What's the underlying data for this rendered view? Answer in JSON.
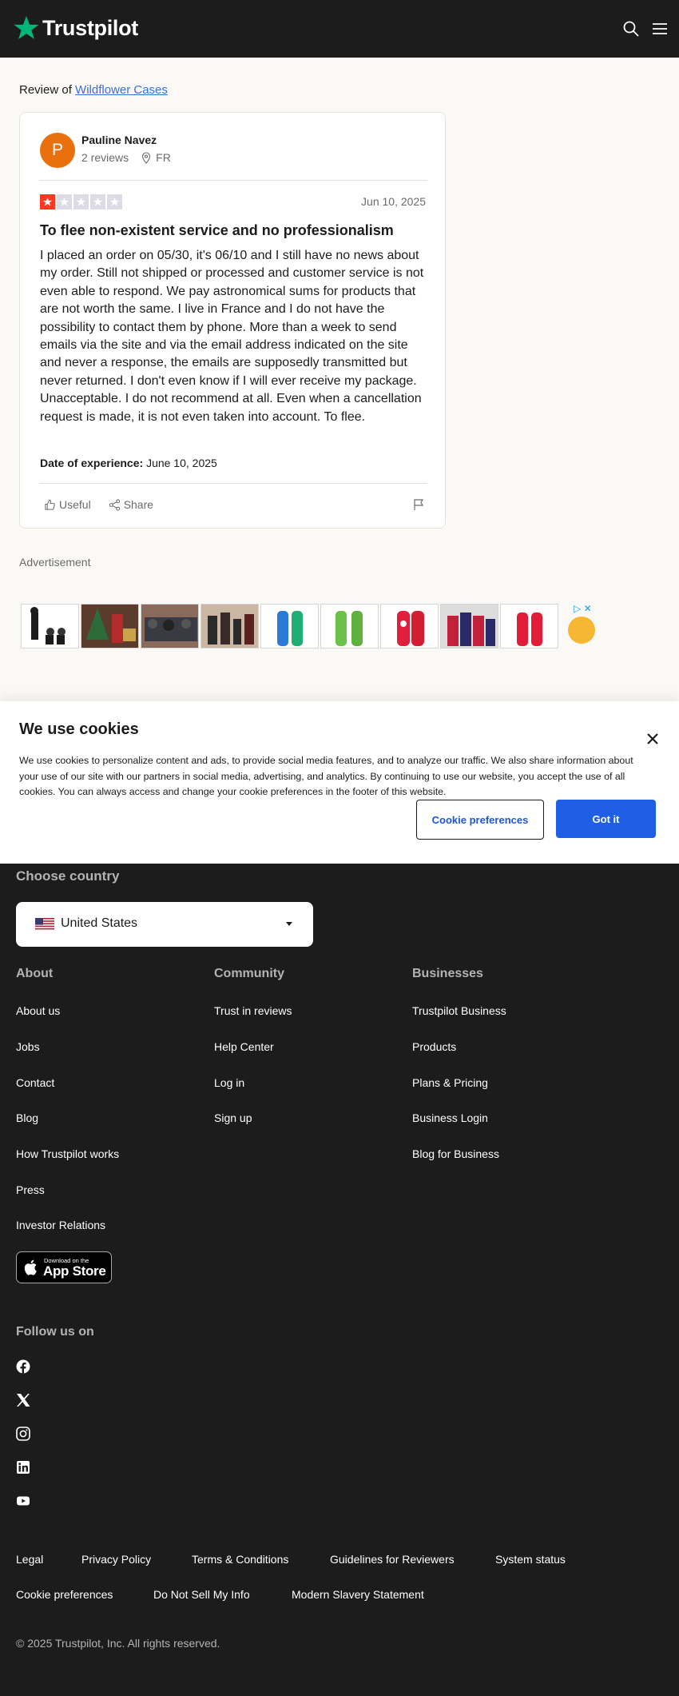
{
  "header": {
    "brand": "Trustpilot"
  },
  "review_of": {
    "prefix": "Review of",
    "company": "Wildflower Cases"
  },
  "review": {
    "avatar_letter": "P",
    "author": "Pauline Navez",
    "review_count": "2 reviews",
    "country": "FR",
    "rating": 1,
    "rating_max": 5,
    "date": "Jun 10, 2025",
    "title": "To flee non-existent service and no professionalism",
    "body": "I placed an order on 05/30, it's 06/10 and I still have no news about my order. Still not shipped or processed and customer service is not even able to respond. We pay astronomical sums for products that are not worth the same. I live in France and I do not have the possibility to contact them by phone. More than a week to send emails via the site and via the email address indicated on the site and never a response, the emails are supposedly transmitted but never returned. I don't even know if I will ever receive my package. Unacceptable. I do not recommend at all. Even when a cancellation request is made, it is not even taken into account. To flee.",
    "experience_label": "Date of experience:",
    "experience_date": "June 10, 2025",
    "useful_label": "Useful",
    "share_label": "Share"
  },
  "ad": {
    "label": "Advertisement"
  },
  "cookie": {
    "title": "We use cookies",
    "text": "We use cookies to personalize content and ads, to provide social media features, and to analyze our traffic. We also share information about your use of our site with our partners in social media, advertising, and analytics. By continuing to use our website, you accept the use of all cookies. You can always access and change your cookie preferences in the footer of this website.",
    "preferences_label": "Cookie preferences",
    "accept_label": "Got it"
  },
  "footer": {
    "country_heading": "Choose country",
    "country_selected": "United States",
    "columns": [
      {
        "heading": "About",
        "links": [
          "About us",
          "Jobs",
          "Contact",
          "Blog",
          "How Trustpilot works",
          "Press",
          "Investor Relations"
        ]
      },
      {
        "heading": "Community",
        "links": [
          "Trust in reviews",
          "Help Center",
          "Log in",
          "Sign up"
        ]
      },
      {
        "heading": "Businesses",
        "links": [
          "Trustpilot Business",
          "Products",
          "Plans & Pricing",
          "Business Login",
          "Blog for Business"
        ]
      }
    ],
    "app_store": {
      "small": "Download on the",
      "big": "App Store"
    },
    "follow_heading": "Follow us on",
    "social": [
      "facebook-icon",
      "x-icon",
      "instagram-icon",
      "linkedin-icon",
      "youtube-icon"
    ],
    "legal_row1": [
      "Legal",
      "Privacy Policy",
      "Terms & Conditions",
      "Guidelines for Reviewers",
      "System status"
    ],
    "legal_row2": [
      "Cookie preferences",
      "Do Not Sell My Info",
      "Modern Slavery Statement"
    ],
    "copyright": "© 2025 Trustpilot, Inc. All rights reserved."
  },
  "colors": {
    "brand_green": "#00b67a",
    "star_red": "#ff3722",
    "link_blue": "#3b6fd6",
    "accept_blue": "#1f5fe6",
    "footer_bg": "#1c1c1c"
  }
}
